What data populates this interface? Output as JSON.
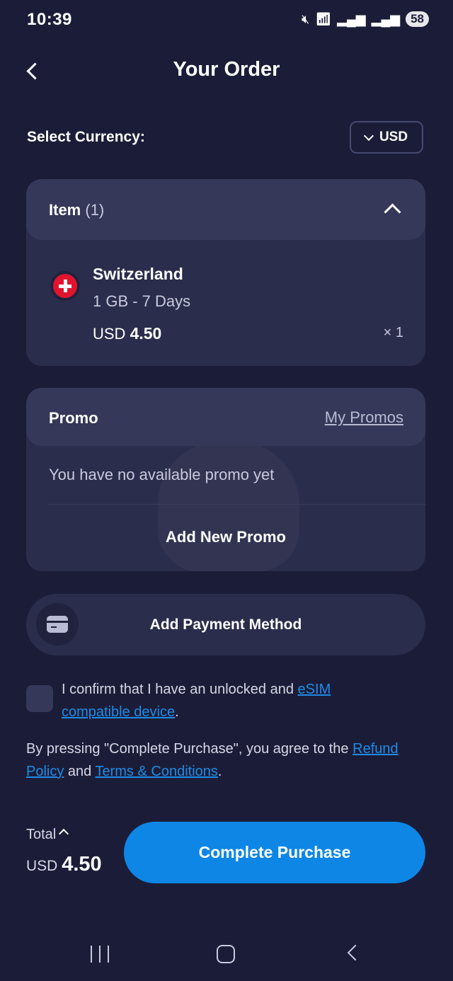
{
  "status_bar": {
    "time": "10:39",
    "battery": "58",
    "icons": [
      "mute-icon",
      "wifi-icon",
      "signal-icon",
      "signal-roaming-icon"
    ]
  },
  "header": {
    "title": "Your Order",
    "back_icon": "chevron-left-icon"
  },
  "currency": {
    "label": "Select Currency:",
    "selected": "USD"
  },
  "item_card": {
    "title": "Item",
    "count": "(1)",
    "items": [
      {
        "country": "Switzerland",
        "plan": "1 GB - 7 Days",
        "currency": "USD",
        "price": "4.50",
        "quantity": "× 1"
      }
    ]
  },
  "promo_card": {
    "title": "Promo",
    "my_promos": "My Promos",
    "empty_text": "You have no available promo yet",
    "add_new": "Add New Promo"
  },
  "payment": {
    "label": "Add Payment Method"
  },
  "confirm": {
    "text_before": "I confirm that I have an unlocked and ",
    "link": "eSIM compatible device",
    "text_after": "."
  },
  "terms": {
    "text_before": "By pressing \"Complete Purchase\", you agree to the ",
    "refund_link": "Refund Policy",
    "middle": " and ",
    "terms_link": "Terms & Conditions",
    "text_after": "."
  },
  "total": {
    "label": "Total",
    "currency": "USD",
    "amount": "4.50"
  },
  "cta": {
    "label": "Complete Purchase"
  },
  "colors": {
    "background": "#1b1d38",
    "card": "#2b2d4c",
    "card_header": "#363859",
    "accent": "#0d86e6",
    "link": "#1f8be6"
  }
}
